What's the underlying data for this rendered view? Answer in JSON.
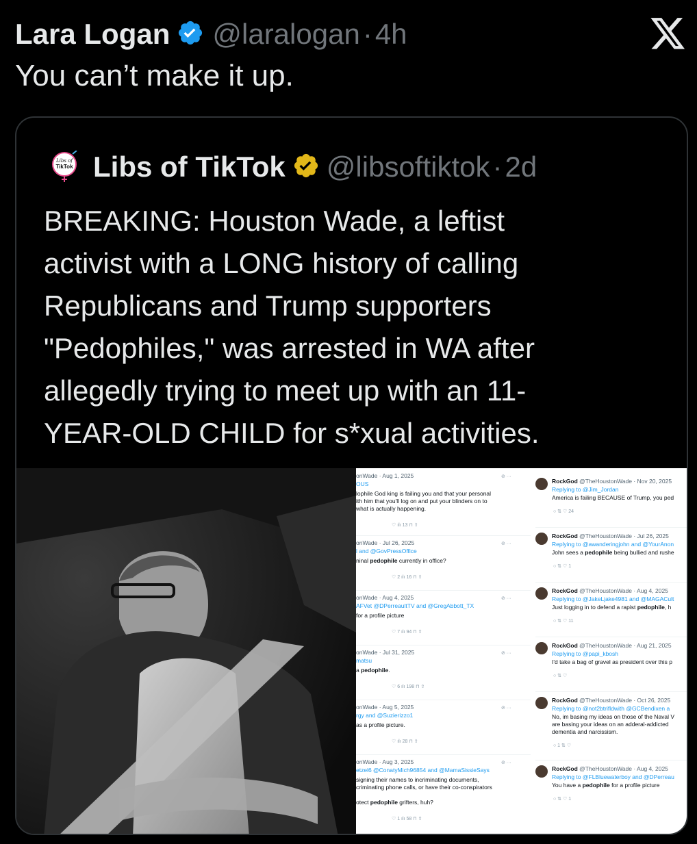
{
  "tweet": {
    "author_name": "Lara Logan",
    "author_handle": "@laralogan",
    "separator": "·",
    "time": "4h",
    "text": "You can’t make it up."
  },
  "quote": {
    "author_name": "Libs of TikTok",
    "author_handle": "@libsoftiktok",
    "separator": "·",
    "time": "2d",
    "avatar_text": "Libs of TikTok",
    "text_lines": [
      "BREAKING: Houston Wade, a leftist",
      "activist with a LONG history of calling",
      "Republicans and Trump supporters",
      "\"Pedophiles,\" was arrested in WA after",
      "allegedly trying to meet up with an 11-",
      "YEAR-OLD CHILD for s*xual activities."
    ]
  },
  "screenshot_left": [
    {
      "meta": "onWade · Aug 1, 2025",
      "reply": "OUS",
      "lines": [
        "lophile God king is failing you and that your personal",
        "ith him that you'll log on and put your blinders on to",
        "what is actually happening."
      ],
      "views": "13",
      "likes": ""
    },
    {
      "meta": "onWade · Jul 26, 2025",
      "reply": "l and @GovPressOffice",
      "lines": [
        "ninal pedophile currently in office?"
      ],
      "replies": "2",
      "views": "16"
    },
    {
      "meta": "onWade · Aug 4, 2025",
      "reply": "AFVet @DPerreaultTV and @GregAbbott_TX",
      "lines": [
        "for a profile picture"
      ],
      "likes": "7",
      "views": "94"
    },
    {
      "meta": "onWade · Jul 31, 2025",
      "reply": "matsu",
      "lines": [
        "a pedophile."
      ],
      "likes": "6",
      "views": "198"
    },
    {
      "meta": "onWade · Aug 5, 2025",
      "reply": "rgy and @Suzierizzo1",
      "lines": [
        "as a profile picture."
      ],
      "views": "28"
    },
    {
      "meta": "onWade · Aug 3, 2025",
      "reply": "etzel6 @ConatyMich96854 and @MamaSissieSays",
      "lines": [
        "signing their names to incriminating documents,",
        "criminating phone calls, or have their co-conspirators",
        "",
        "otect pedophile grifters, huh?"
      ],
      "likes": "1",
      "views": "58"
    }
  ],
  "screenshot_right": [
    {
      "name": "RockGod",
      "meta": "@TheHoustonWade · Nov 20, 2025",
      "reply": "Replying to @Jim_Jordan",
      "lines": [
        "America is failing BECAUSE of Trump, you ped"
      ],
      "likes": "24"
    },
    {
      "name": "RockGod",
      "meta": "@TheHoustonWade · Jul 26, 2025",
      "reply": "Replying to @awanderingjohn and @YourAnon",
      "lines": [
        "John sees a pedophile being bullied and rushe"
      ],
      "likes": "1"
    },
    {
      "name": "RockGod",
      "meta": "@TheHoustonWade · Aug 4, 2025",
      "reply": "Replying to @JakeLjake4981 and @MAGACult",
      "lines": [
        "Just logging in to defend a rapist pedophile, h"
      ],
      "likes": "11"
    },
    {
      "name": "RockGod",
      "meta": "@TheHoustonWade · Aug 21, 2025",
      "reply": "Replying to @papi_kbosh",
      "lines": [
        "I'd take a bag of gravel as president over this p"
      ],
      "likes": ""
    },
    {
      "name": "RockGod",
      "meta": "@TheHoustonWade · Oct 26, 2025",
      "reply": "Replying to @not2btrifldwith @GCBendixen a",
      "lines": [
        "No, im basing my ideas on those of the Naval V",
        "are basing your ideas on an adderal-addicted",
        "dementia and narcissism."
      ],
      "replies": "1"
    },
    {
      "name": "RockGod",
      "meta": "@TheHoustonWade · Aug 4, 2025",
      "reply": "Replying to @FLBluewaterboy and @DPerreau",
      "lines": [
        "You have a pedophile for a profile picture"
      ],
      "likes": "1"
    }
  ],
  "colors": {
    "background": "#000000",
    "text": "#e7e9ea",
    "muted": "#71767b",
    "verified_blue": "#1d9bf0",
    "verified_gold": "#e2b719",
    "border": "#2f3336"
  }
}
